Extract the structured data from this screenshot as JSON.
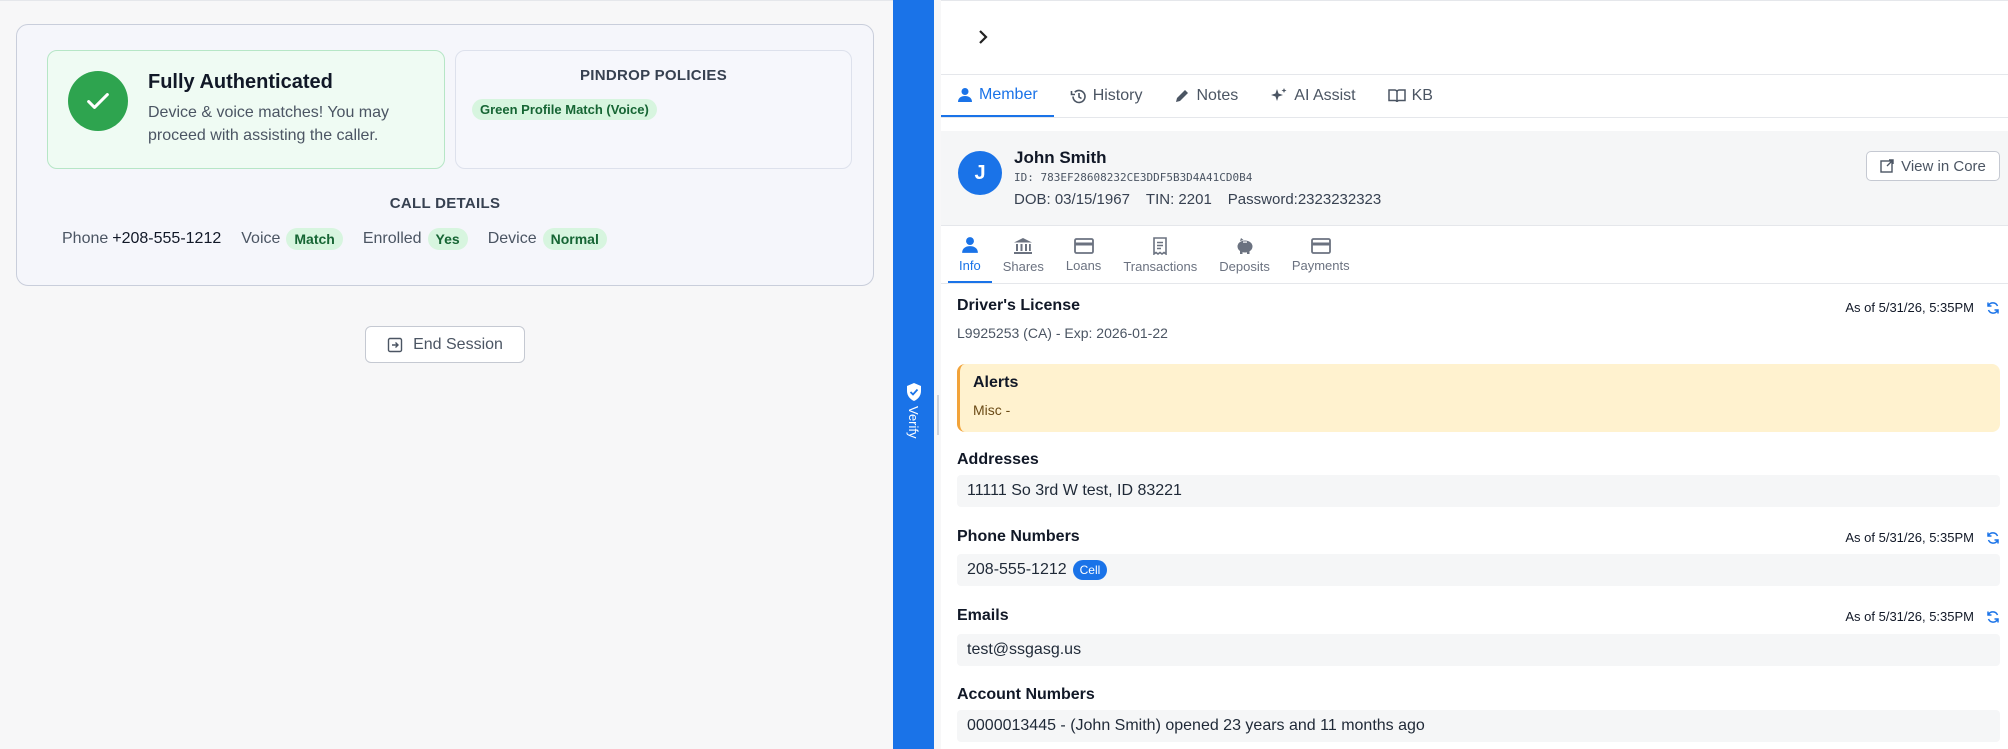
{
  "auth": {
    "status_title": "Fully Authenticated",
    "status_desc": "Device & voice matches! You may proceed with assisting the caller.",
    "policies_title": "PINDROP POLICIES",
    "policy": "Green Profile Match (Voice)",
    "call_title": "CALL DETAILS",
    "phone_label": "Phone",
    "phone_value": "+208-555-1212",
    "voice_label": "Voice",
    "voice_value": "Match",
    "enrolled_label": "Enrolled",
    "enrolled_value": "Yes",
    "device_label": "Device",
    "device_value": "Normal",
    "end_session": "End Session"
  },
  "verify_label": "Verify",
  "tabs": [
    {
      "label": "Member",
      "icon": "person-icon"
    },
    {
      "label": "History",
      "icon": "history-icon"
    },
    {
      "label": "Notes",
      "icon": "pencil-icon"
    },
    {
      "label": "AI Assist",
      "icon": "sparkle-icon"
    },
    {
      "label": "KB",
      "icon": "book-icon"
    }
  ],
  "member": {
    "initial": "J",
    "name": "John Smith",
    "id": "ID: 783EF28608232CE3DDF5B3D4A41CD0B4",
    "dob": "DOB: 03/15/1967",
    "tin": "TIN: 2201",
    "password": "Password:2323232323",
    "view_core": "View in Core"
  },
  "subtabs": [
    {
      "label": "Info",
      "icon": "person-icon"
    },
    {
      "label": "Shares",
      "icon": "bank-icon"
    },
    {
      "label": "Loans",
      "icon": "card-icon"
    },
    {
      "label": "Transactions",
      "icon": "receipt-icon"
    },
    {
      "label": "Deposits",
      "icon": "piggy-bank-icon"
    },
    {
      "label": "Payments",
      "icon": "card-icon"
    }
  ],
  "info": {
    "license_title": "Driver's License",
    "license_value": "L9925253 (CA) - Exp: 2026-01-22",
    "asof": "As of 5/31/26, 5:35PM",
    "alerts_title": "Alerts",
    "alerts_text": "Misc -",
    "addresses_title": "Addresses",
    "address": "11111 So 3rd W test, ID 83221",
    "phones_title": "Phone Numbers",
    "phone": "208-555-1212",
    "phone_type": "Cell",
    "emails_title": "Emails",
    "email": "test@ssgasg.us",
    "accounts_title": "Account Numbers",
    "account": "0000013445 - (John Smith) opened 23 years and 11 months ago"
  },
  "colors": {
    "accent": "#1a73e8",
    "success": "#2ea44f",
    "alert_bg": "#fff2cf"
  }
}
